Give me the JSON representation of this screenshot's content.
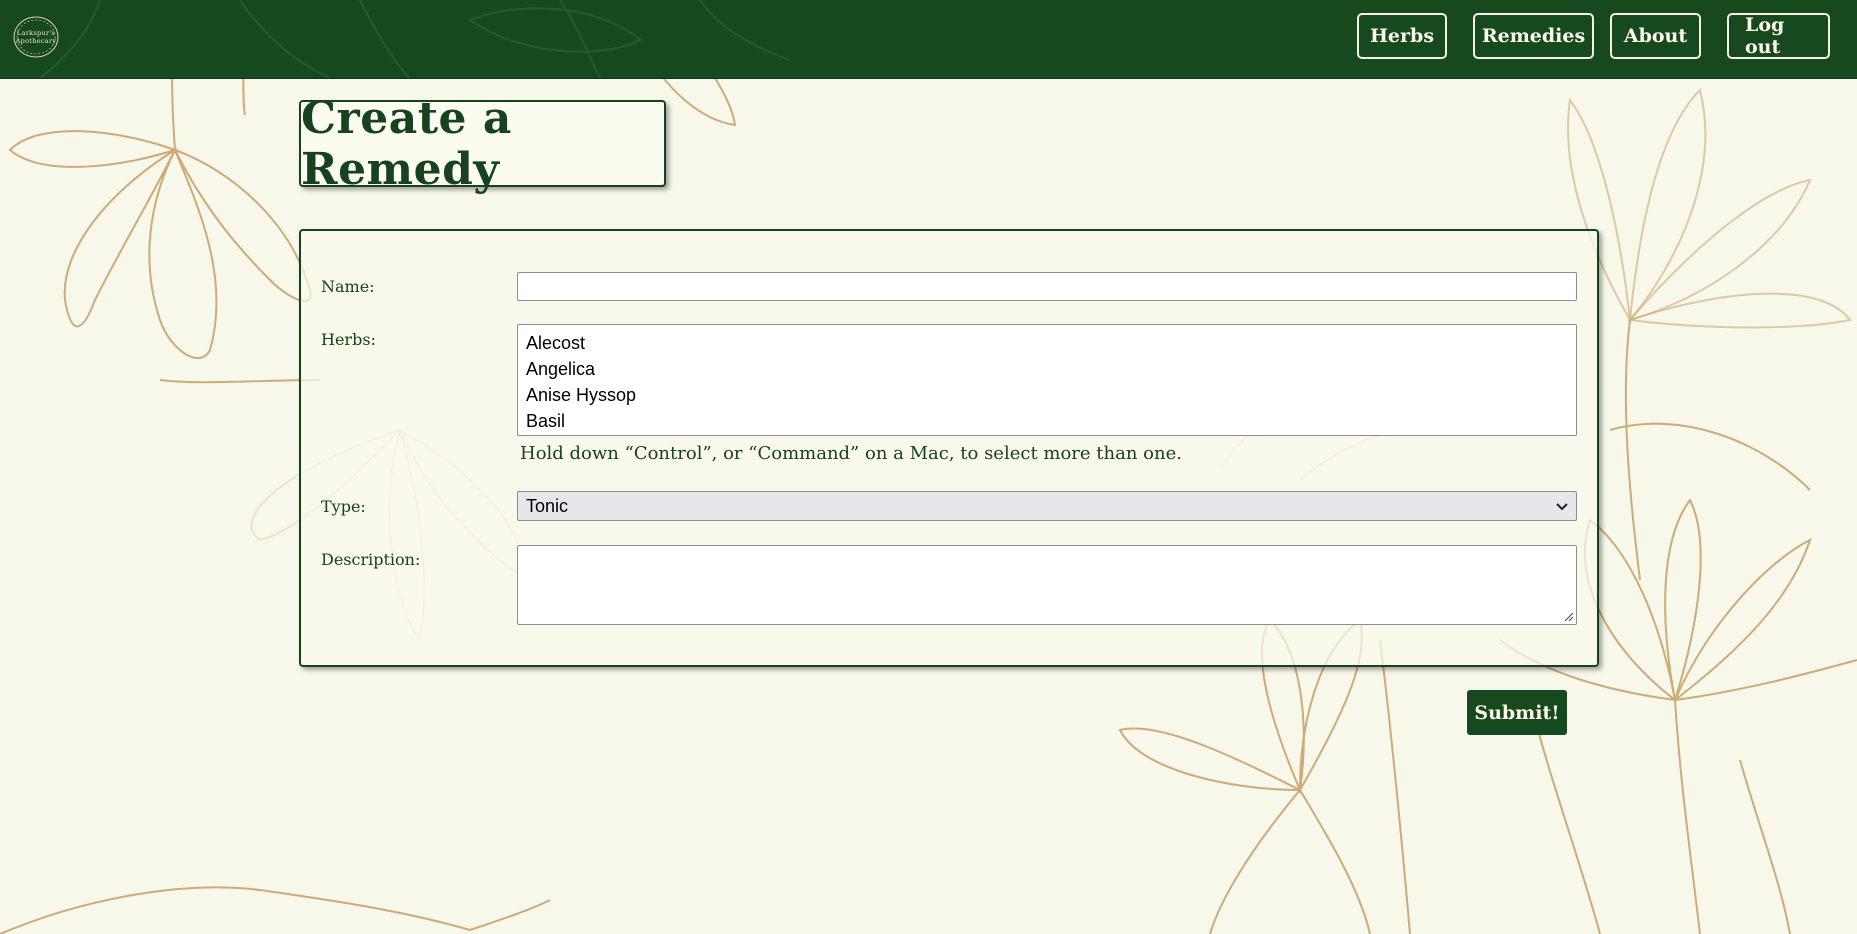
{
  "header": {
    "logo_line1": "Larkspur's",
    "logo_line2": "Apothecary",
    "nav": {
      "herbs": "Herbs",
      "remedies": "Remedies",
      "about": "About",
      "logout": "Log out"
    }
  },
  "page": {
    "title": "Create a Remedy"
  },
  "form": {
    "name_label": "Name:",
    "name_value": "",
    "herbs_label": "Herbs:",
    "herbs_options": [
      "Alecost",
      "Angelica",
      "Anise Hyssop",
      "Basil"
    ],
    "herbs_hint": "Hold down “Control”, or “Command” on a Mac, to select more than one.",
    "type_label": "Type:",
    "type_value": "Tonic",
    "description_label": "Description:",
    "description_value": "",
    "submit_label": "Submit!"
  },
  "colors": {
    "brand_green": "#17491f",
    "background": "#f7f7ea",
    "line_art_gold": "#c9a26a"
  }
}
